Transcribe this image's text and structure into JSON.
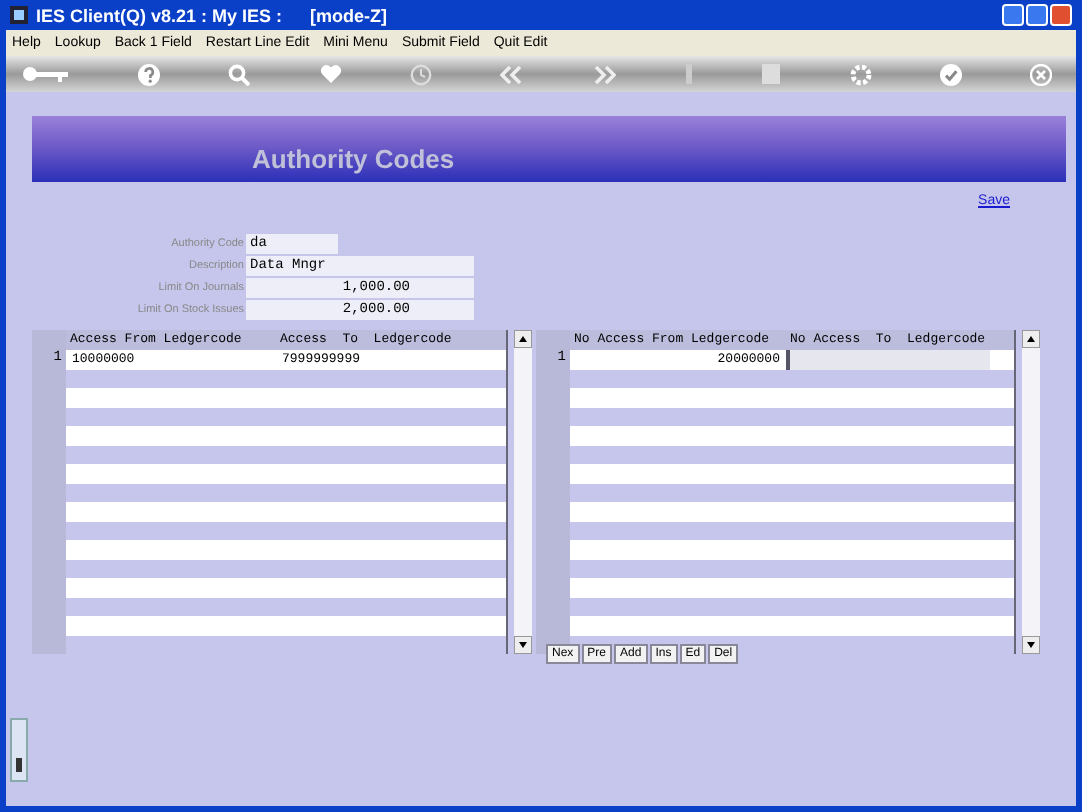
{
  "window": {
    "title": "IES Client(Q) v8.21 : My IES :",
    "mode": "[mode-Z]"
  },
  "menu": [
    "Help",
    "Lookup",
    "Back 1 Field",
    "Restart Line Edit",
    "Mini Menu",
    "Submit Field",
    "Quit Edit"
  ],
  "banner": {
    "title": "Authority Codes"
  },
  "save_link": "Save",
  "fields": [
    {
      "label": "Authority Code",
      "value": "da",
      "kind": "short"
    },
    {
      "label": "Description",
      "value": "Data Mngr",
      "kind": "text"
    },
    {
      "label": "Limit On Journals",
      "value": "1,000.00",
      "kind": "amount"
    },
    {
      "label": "Limit On Stock Issues",
      "value": "2,000.00",
      "kind": "amount"
    }
  ],
  "grids": [
    {
      "columns": [
        "Access From Ledgercode",
        "Access  To  Ledgercode"
      ],
      "rows": [
        {
          "number": "1",
          "cells": [
            {
              "value": "10000000",
              "focused": false
            },
            {
              "value": "7999999999",
              "focused": false
            }
          ]
        }
      ]
    },
    {
      "columns": [
        "No Access From Ledgercode",
        "No Access  To  Ledgercode"
      ],
      "rows": [
        {
          "number": "1",
          "cells": [
            {
              "value": "20000000",
              "focused": false
            },
            {
              "focused": true
            }
          ]
        }
      ]
    }
  ],
  "grid_buttons": [
    "Nex",
    "Pre",
    "Add",
    "Ins",
    "Ed",
    "Del"
  ]
}
